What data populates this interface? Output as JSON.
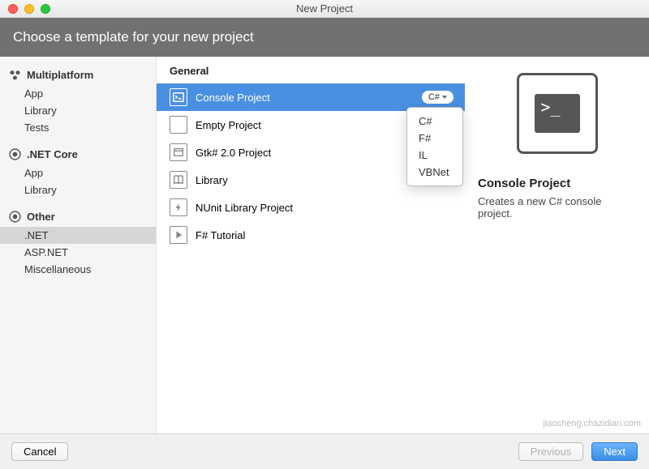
{
  "window": {
    "title": "New Project"
  },
  "banner": {
    "text": "Choose a template for your new project"
  },
  "sidebar": {
    "categories": [
      {
        "id": "multiplatform",
        "label": "Multiplatform",
        "items": [
          {
            "label": "App"
          },
          {
            "label": "Library"
          },
          {
            "label": "Tests"
          }
        ]
      },
      {
        "id": "netcore",
        "label": ".NET Core",
        "items": [
          {
            "label": "App"
          },
          {
            "label": "Library"
          }
        ]
      },
      {
        "id": "other",
        "label": "Other",
        "items": [
          {
            "label": ".NET",
            "selected": true
          },
          {
            "label": "ASP.NET"
          },
          {
            "label": "Miscellaneous"
          }
        ]
      }
    ]
  },
  "templates": {
    "section": "General",
    "items": [
      {
        "label": "Console Project",
        "selected": true,
        "lang": "C#"
      },
      {
        "label": "Empty Project"
      },
      {
        "label": "Gtk# 2.0 Project"
      },
      {
        "label": "Library"
      },
      {
        "label": "NUnit Library Project"
      },
      {
        "label": "F# Tutorial"
      }
    ]
  },
  "langDropdown": {
    "options": [
      "C#",
      "F#",
      "IL",
      "VBNet"
    ]
  },
  "detail": {
    "title": "Console Project",
    "description": "Creates a new C# console project.",
    "prompt": ">_"
  },
  "footer": {
    "cancel": "Cancel",
    "previous": "Previous",
    "next": "Next"
  },
  "watermark": "jiaocheng.chazidian.com"
}
